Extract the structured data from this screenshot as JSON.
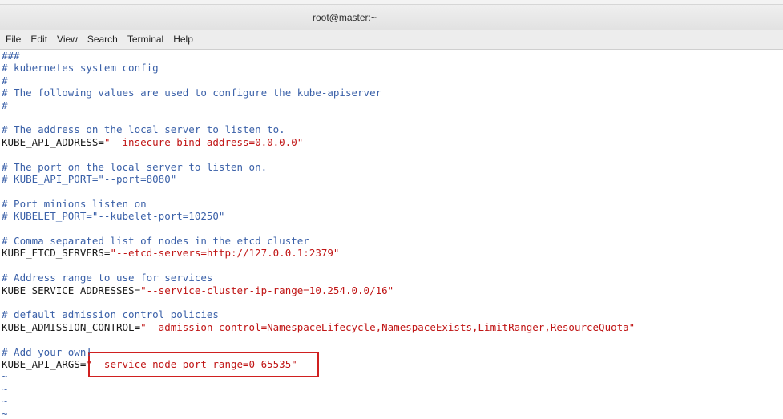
{
  "window": {
    "title": "root@master:~"
  },
  "menu": {
    "items": [
      "File",
      "Edit",
      "View",
      "Search",
      "Terminal",
      "Help"
    ]
  },
  "terminal": {
    "lines": [
      {
        "type": "comment",
        "text": "###"
      },
      {
        "type": "comment",
        "text": "# kubernetes system config"
      },
      {
        "type": "comment",
        "text": "#"
      },
      {
        "type": "comment",
        "text": "# The following values are used to configure the kube-apiserver"
      },
      {
        "type": "comment",
        "text": "#"
      },
      {
        "type": "blank",
        "text": ""
      },
      {
        "type": "comment",
        "text": "# The address on the local server to listen to."
      },
      {
        "type": "assign",
        "key": "KUBE_API_ADDRESS=",
        "value": "\"--insecure-bind-address=0.0.0.0\""
      },
      {
        "type": "blank",
        "text": ""
      },
      {
        "type": "comment",
        "text": "# The port on the local server to listen on."
      },
      {
        "type": "comment",
        "text": "# KUBE_API_PORT=\"--port=8080\""
      },
      {
        "type": "blank",
        "text": ""
      },
      {
        "type": "comment",
        "text": "# Port minions listen on"
      },
      {
        "type": "comment",
        "text": "# KUBELET_PORT=\"--kubelet-port=10250\""
      },
      {
        "type": "blank",
        "text": ""
      },
      {
        "type": "comment",
        "text": "# Comma separated list of nodes in the etcd cluster"
      },
      {
        "type": "assign",
        "key": "KUBE_ETCD_SERVERS=",
        "value": "\"--etcd-servers=http://127.0.0.1:2379\""
      },
      {
        "type": "blank",
        "text": ""
      },
      {
        "type": "comment",
        "text": "# Address range to use for services"
      },
      {
        "type": "assign",
        "key": "KUBE_SERVICE_ADDRESSES=",
        "value": "\"--service-cluster-ip-range=10.254.0.0/16\""
      },
      {
        "type": "blank",
        "text": ""
      },
      {
        "type": "comment",
        "text": "# default admission control policies"
      },
      {
        "type": "assign",
        "key": "KUBE_ADMISSION_CONTROL=",
        "value": "\"--admission-control=NamespaceLifecycle,NamespaceExists,LimitRanger,ResourceQuota\""
      },
      {
        "type": "blank",
        "text": ""
      },
      {
        "type": "comment",
        "text": "# Add your own!"
      },
      {
        "type": "assign",
        "key": "KUBE_API_ARGS=",
        "value": "\"--service-node-port-range=0-65535\""
      },
      {
        "type": "tilde",
        "text": "~"
      },
      {
        "type": "tilde",
        "text": "~"
      },
      {
        "type": "tilde",
        "text": "~"
      },
      {
        "type": "tilde",
        "text": "~"
      }
    ]
  },
  "colors": {
    "comment": "#3a60a8",
    "value": "#c01515",
    "highlight_box": "#d02020"
  }
}
